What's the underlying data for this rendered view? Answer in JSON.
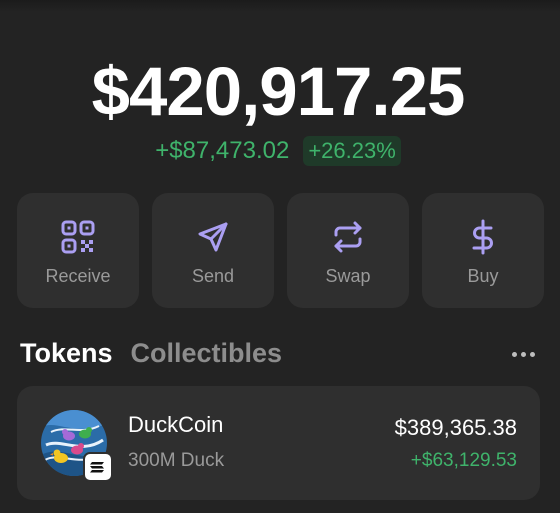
{
  "wallet": {
    "balance": "$420,917.25",
    "change_amount": "+$87,473.02",
    "change_percent": "+26.23%"
  },
  "actions": [
    {
      "label": "Receive",
      "icon": "qr-code-icon"
    },
    {
      "label": "Send",
      "icon": "paper-plane-icon"
    },
    {
      "label": "Swap",
      "icon": "swap-arrows-icon"
    },
    {
      "label": "Buy",
      "icon": "dollar-icon"
    }
  ],
  "tabs": {
    "tokens": "Tokens",
    "collectibles": "Collectibles",
    "more_icon": "more-horizontal-icon"
  },
  "tokens": [
    {
      "name": "DuckCoin",
      "amount": "300M Duck",
      "value": "$389,365.38",
      "change": "+$63,129.53",
      "icon": "duckcoin-logo",
      "chain_badge": "solana-badge-icon"
    }
  ],
  "colors": {
    "background": "#232323",
    "card": "#2f2f2f",
    "accent": "#ab9ff2",
    "positive": "#3fb36b",
    "positive_bg": "#1f3a29",
    "muted": "#9a9a9a"
  }
}
